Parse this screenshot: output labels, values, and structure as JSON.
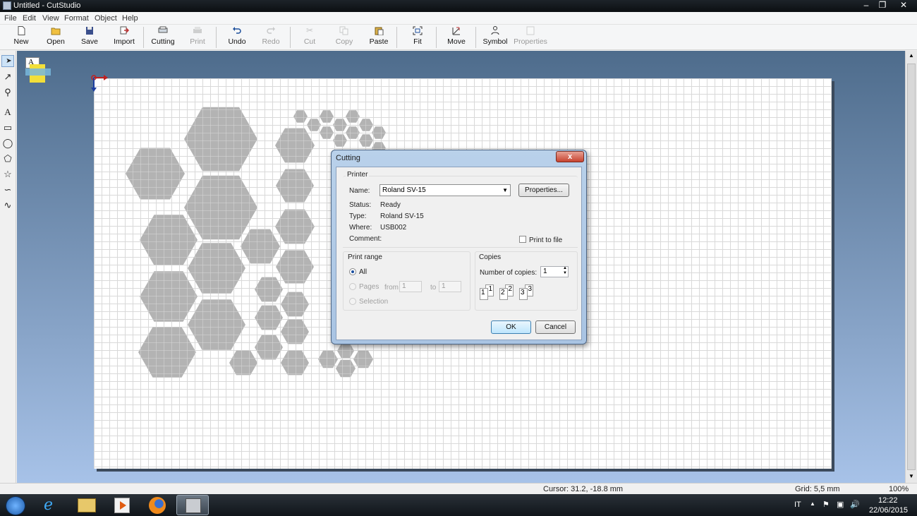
{
  "window": {
    "title": "Untitled - CutStudio",
    "controls": [
      "minimize",
      "restore",
      "close"
    ]
  },
  "menubar": {
    "items": [
      "File",
      "Edit",
      "View",
      "Format",
      "Object",
      "Help"
    ]
  },
  "toolbar": {
    "new": "New",
    "open": "Open",
    "save": "Save",
    "import": "Import",
    "cutting": "Cutting",
    "print": "Print",
    "undo": "Undo",
    "redo": "Redo",
    "cut": "Cut",
    "copy": "Copy",
    "paste": "Paste",
    "fit": "Fit",
    "move": "Move",
    "symbol": "Symbol",
    "properties": "Properties"
  },
  "left_tools": [
    "select-arrow",
    "node-edit",
    "zoom",
    "text",
    "rectangle",
    "ellipse",
    "polygon",
    "star",
    "polyline",
    "curve"
  ],
  "dialog": {
    "title": "Cutting",
    "close": "x",
    "printer_group": "Printer",
    "name_label": "Name:",
    "name_value": "Roland SV-15",
    "properties_button": "Properties...",
    "status_label": "Status:",
    "status_value": "Ready",
    "type_label": "Type:",
    "type_value": "Roland SV-15",
    "where_label": "Where:",
    "where_value": "USB002",
    "comment_label": "Comment:",
    "print_to_file": "Print to file",
    "range_group": "Print range",
    "all_label": "All",
    "pages_label": "Pages",
    "from_label": "from",
    "from_value": "1",
    "to_label": "to",
    "to_value": "1",
    "selection_label": "Selection",
    "copies_group": "Copies",
    "copies_label": "Number of copies:",
    "copies_value": "1",
    "collate_numbers": [
      "1",
      "1",
      "2",
      "2",
      "3",
      "3"
    ],
    "ok": "OK",
    "cancel": "Cancel"
  },
  "statusbar": {
    "cursor": "Cursor: 31.2, -18.8 mm",
    "grid": "Grid: 5,5 mm",
    "zoom": "100%"
  },
  "taskbar": {
    "lang": "IT",
    "time": "12:22",
    "date": "22/06/2015"
  },
  "colors": {
    "paper": "#ffffff",
    "hexagon": "#b3b3b3",
    "canvas_top": "#4e6c8c",
    "canvas_bottom": "#a7c2e8"
  }
}
